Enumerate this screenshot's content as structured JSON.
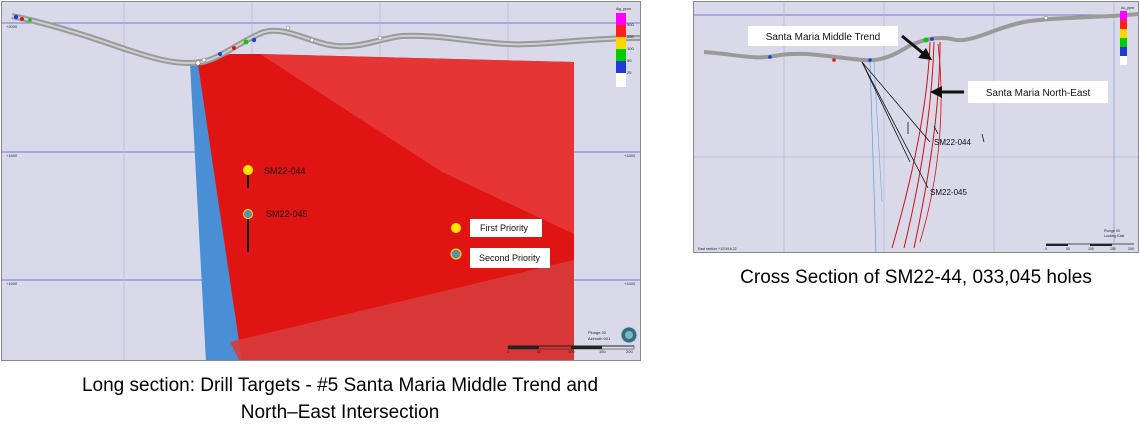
{
  "long_section": {
    "caption_line1": "Long section: Drill Targets - #5  Santa Maria Middle Trend and",
    "caption_line2": "North–East Intersection",
    "legend_title": "Ag_ppm",
    "legend_values": [
      "500",
      "250",
      "100",
      "50",
      "25"
    ],
    "legend_colors": [
      "#ff00ff",
      "#ff2020",
      "#ffd700",
      "#00cc00",
      "#1f3bd6",
      "#ffffff"
    ],
    "drill_targets": [
      {
        "label": "SM22-044",
        "priority": "First Priority"
      },
      {
        "label": "SM22-045",
        "priority": "Second Priority"
      }
    ],
    "priority_legend": [
      {
        "label": "First Priority",
        "color": "#ffe600"
      },
      {
        "label": "Second Priority",
        "color": "#5f8fa8"
      }
    ],
    "scale_labels": [
      "0",
      "50",
      "100",
      "150",
      "200"
    ],
    "view_info": [
      "Plunge 00",
      "Azimuth 001"
    ],
    "elevation_labels": [
      "+2000",
      "+1800",
      "+1600"
    ]
  },
  "cross_section": {
    "caption": "Cross Section of SM22-44, 033,045 holes",
    "legend_title": "Au_ppm",
    "trend_labels": [
      "Santa Maria Middle Trend",
      "Santa Maria North-East"
    ],
    "hole_labels": [
      "SM22-044",
      "SM22-045"
    ],
    "scale_labels": [
      "0",
      "50",
      "100",
      "150",
      "200"
    ],
    "view_info": [
      "Plunge 00",
      "Looking East"
    ],
    "section_label": "East section +121016.22"
  },
  "colors": {
    "background": "#d9d9ea",
    "mineral_zone": "#e11414",
    "fault_zone": "#4a8fd6",
    "first_priority": "#ffe600",
    "second_priority": "#5f8fa8"
  }
}
